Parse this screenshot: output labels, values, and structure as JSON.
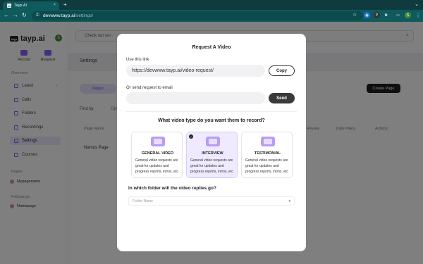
{
  "browser": {
    "tab_title": "Tayp AI",
    "url_host": "devwww.tayp.ai",
    "url_path": "/settings/",
    "avatar_letter": "S"
  },
  "app": {
    "brand": "tayp.ai",
    "logo_mark": "tayp",
    "user_initial": "S",
    "quick_actions": [
      "Record",
      "Request"
    ],
    "sections": {
      "overview": "Overview",
      "pages": "Pages",
      "followings": "Followings"
    },
    "nav": [
      "Latest",
      "Calls",
      "Folders",
      "Recordings",
      "Settings",
      "Courses"
    ],
    "pages": [
      "Mypagename"
    ],
    "followings": [
      "Namepage"
    ],
    "banner_text": "Check out our",
    "settings_title": "Settings",
    "pill_label": "Pages",
    "create_page": "Create Page",
    "find_by": "Find by",
    "find_by_option": "Ope",
    "table_headers": [
      "Page Name",
      "Review",
      "Date Plans",
      "Actions"
    ],
    "table_row": [
      "Namus Page"
    ]
  },
  "modal": {
    "title": "Request A Video",
    "use_link_label": "Use this link",
    "link_value": "https://devwww.tayp.ai/video-request/",
    "copy_label": "Copy",
    "email_label": "Or send request to email",
    "email_placeholder": "",
    "send_label": "Send",
    "question": "What video type do you want them to record?",
    "cards": [
      {
        "title": "GENERAL VIDEO",
        "desc": "General video requests are great for updates and progress reports, intros, etc",
        "selected": false
      },
      {
        "title": "INTERVIEW",
        "desc": "General video requests are great for updates and progress reports, intros, etc",
        "selected": true
      },
      {
        "title": "TESTIMONIAL",
        "desc": "General video requests are great for updates and progress reports, intros, etc",
        "selected": false
      }
    ],
    "folder_question": "In which folder will the video replies go?",
    "folder_placeholder": "Folder Name"
  },
  "colors": {
    "chrome": "#0e5a5d",
    "accent": "#8a5cf6",
    "selected_card": "#efeaff",
    "send": "#3a3a3a"
  },
  "icons": [
    "back-icon",
    "forward-icon",
    "reload-icon",
    "lock-icon",
    "star-icon",
    "extension-icon",
    "check-icon",
    "chevron-down-icon"
  ]
}
